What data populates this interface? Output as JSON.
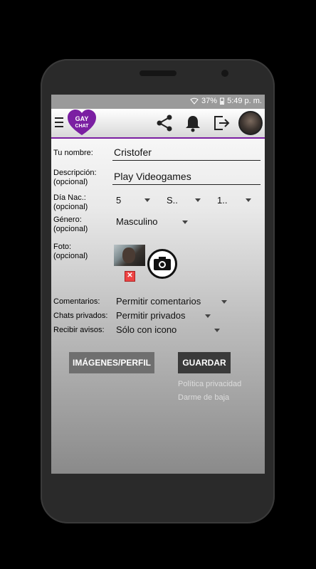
{
  "status": {
    "signal_icon": "wifi-icon",
    "battery_percent": "37%",
    "time": "5:49 p. m."
  },
  "appbar": {
    "logo_line1": "GAY",
    "logo_line2": "CHAT",
    "share_icon": "share-icon",
    "bell_icon": "bell-icon",
    "logout_icon": "logout-icon"
  },
  "form": {
    "name_label": "Tu nombre:",
    "name_value": "Cristofer",
    "desc_label": "Descripción:",
    "desc_optional": "(opcional)",
    "desc_value": "Play Videogames",
    "birth_label": "Día Nac.:",
    "birth_optional": "(opcional)",
    "birth_day": "5",
    "birth_month": "S..",
    "birth_year": "1..",
    "gender_label": "Género:",
    "gender_optional": "(opcional)",
    "gender_value": "Masculino",
    "photo_label": "Foto:",
    "photo_optional": "(opcional)",
    "comments_label": "Comentarios:",
    "comments_value": "Permitir comentarios",
    "chats_label": "Chats privados:",
    "chats_value": "Permitir privados",
    "notify_label": "Recibir avisos:",
    "notify_value": "Sólo con icono"
  },
  "buttons": {
    "images_profile": "IMÁGENES/PERFIL",
    "save": "GUARDAR"
  },
  "links": {
    "privacy": "Política privacidad",
    "unsubscribe": "Darme de baja"
  },
  "colors": {
    "accent": "#7b1fa2"
  }
}
